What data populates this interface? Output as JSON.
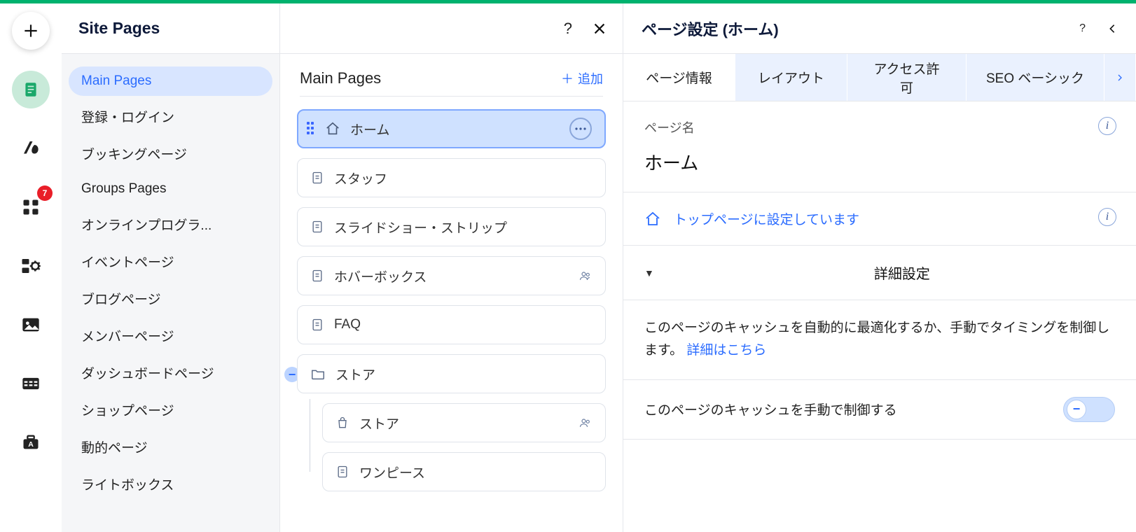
{
  "vtoolbar": {
    "badge": "7"
  },
  "panel1": {
    "title": "Site Pages",
    "items": [
      "Main Pages",
      "登録・ログイン",
      "ブッキングページ",
      "Groups Pages",
      "オンラインプログラ...",
      "イベントページ",
      "ブログページ",
      "メンバーページ",
      "ダッシュボードページ",
      "ショップページ",
      "動的ページ",
      "ライトボックス"
    ]
  },
  "panel2": {
    "title": "Main Pages",
    "add_label": "追加",
    "pages": [
      {
        "label": "ホーム"
      },
      {
        "label": "スタッフ"
      },
      {
        "label": "スライドショー・ストリップ"
      },
      {
        "label": "ホバーボックス"
      },
      {
        "label": "FAQ"
      }
    ],
    "folder": {
      "label": "ストア",
      "children": [
        {
          "label": "ストア"
        },
        {
          "label": "ワンピース"
        }
      ]
    }
  },
  "panel3": {
    "title": "ページ設定 (ホーム)",
    "tabs": [
      "ページ情報",
      "レイアウト",
      "アクセス許可",
      "SEO ベーシック"
    ],
    "page_name_label": "ページ名",
    "page_name_value": "ホーム",
    "homepage_text": "トップページに設定しています",
    "advanced_label": "詳細設定",
    "cache_desc_a": "このページのキャッシュを自動的に最適化するか、手動でタイミングを制御します。",
    "cache_desc_link": "詳細はこちら",
    "manual_cache_label": "このページのキャッシュを手動で制御する"
  }
}
